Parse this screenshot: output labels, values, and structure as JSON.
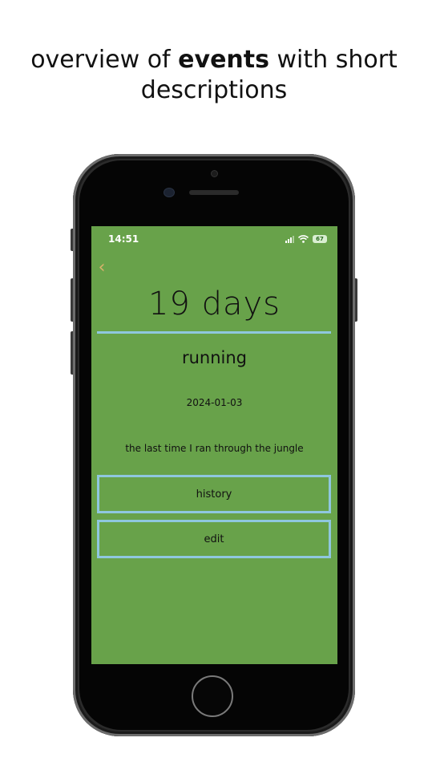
{
  "caption": {
    "prefix": "overview of ",
    "bold": "events",
    "suffix_line1": " with short",
    "line2": "descriptions"
  },
  "status_bar": {
    "time": "14:51",
    "battery": "67"
  },
  "event": {
    "count": "19 days",
    "name": "running",
    "date": "2024-01-03",
    "description": "the last time I ran through the jungle"
  },
  "buttons": {
    "history": "history",
    "edit": "edit"
  },
  "icons": {
    "back": "chevron-left-icon",
    "signal": "cellular-signal-icon",
    "wifi": "wifi-icon",
    "battery": "battery-icon"
  },
  "colors": {
    "screen_background": "#68a24a",
    "accent_border": "#8fc7df",
    "back_chevron": "#d9b26c"
  }
}
